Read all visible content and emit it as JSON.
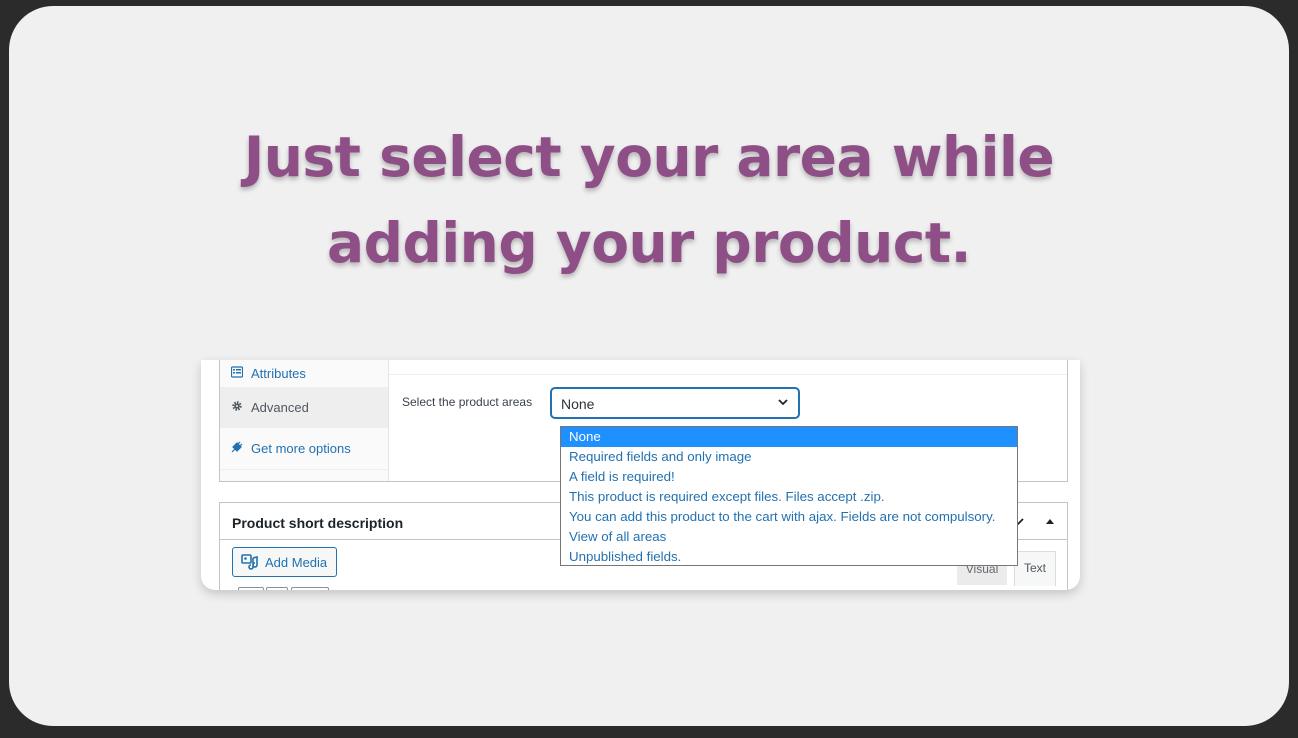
{
  "headline": {
    "line1": "Just select your area while",
    "line2": "adding your product."
  },
  "product_data": {
    "tabs": [
      {
        "label": "Attributes",
        "icon": "list-icon"
      },
      {
        "label": "Advanced",
        "icon": "gear-icon",
        "active": true
      },
      {
        "label": "Get more options",
        "icon": "plugin-icon"
      }
    ],
    "field_label": "Select the product areas",
    "select_value": "None"
  },
  "dropdown": {
    "options": [
      "None",
      "Required fields and only image",
      "A field is required!",
      "This product is required except files. Files accept .zip.",
      "You can add this product to the cart with ajax. Fields are not compulsory.",
      "View of all areas",
      "Unpublished fields."
    ],
    "selected_index": 0
  },
  "short_description": {
    "title": "Product short description",
    "add_media": "Add Media",
    "mode_visual": "Visual",
    "mode_text": "Text"
  },
  "colors": {
    "headline": "#8e4f86",
    "link": "#2271b1",
    "selected_option": "#1e90ff"
  }
}
